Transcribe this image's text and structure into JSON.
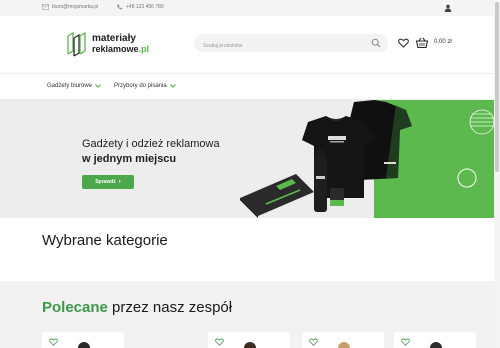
{
  "topbar": {
    "email": "biuro@mojamarka.pl",
    "phone": "+48 123 456 789"
  },
  "header": {
    "logo_line1": "materiały",
    "logo_line2": "reklamowe",
    "logo_suffix": ".pl",
    "search_placeholder": "Szukaj produktów",
    "cart_total": "0,00 zł"
  },
  "nav": {
    "items": [
      {
        "label": "Gadżety biurowe"
      },
      {
        "label": "Przybory do pisania"
      }
    ]
  },
  "hero": {
    "title_line1": "Gadżety i odzież reklamowa",
    "title_line2": "w jednym miejscu",
    "button_label": "Sprawdź"
  },
  "sections": {
    "categories_title": "Wybrane kategorie",
    "featured_accent": "Polecane",
    "featured_rest": " przez nasz zespół"
  },
  "colors": {
    "brand_green": "#4ca84b",
    "accent_green": "#3c9a46",
    "hero_bg": "#ededed"
  }
}
